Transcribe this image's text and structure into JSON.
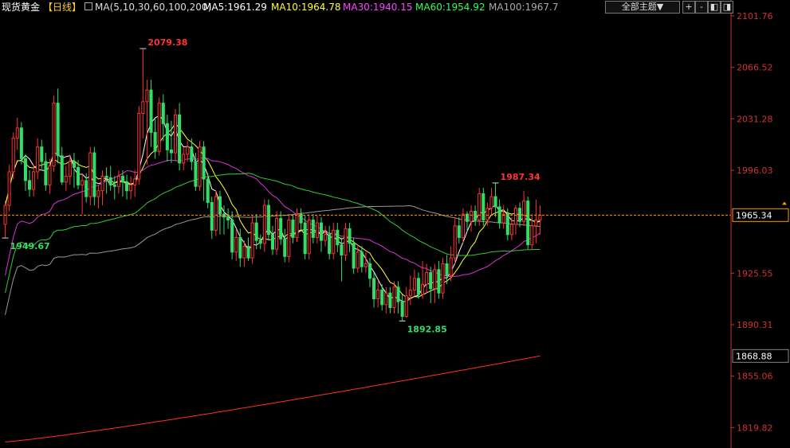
{
  "header": {
    "title": "现货黄金",
    "period": "【日线】",
    "ma_params": "MA(5,10,30,60,100,200)",
    "ma5": "MA5:1961.29",
    "ma10": "MA10:1964.78",
    "ma30": "MA30:1940.15",
    "ma60": "MA60:1954.92",
    "ma100": "MA100:1967.7",
    "theme_select": "全部主题▼",
    "tool_icons": [
      "zoom-in-icon",
      "zoom-out-icon",
      "left-icon",
      "right-icon"
    ],
    "tool_glyphs": [
      "+",
      "-",
      "◧",
      "◨"
    ]
  },
  "colors": {
    "up": "#ff3333",
    "down": "#33dd66",
    "ma5": "#ffffff",
    "ma10": "#ffff33",
    "ma30": "#dd33dd",
    "ma60": "#33cc33",
    "ma100": "#999999",
    "ma200": "#ff3322",
    "axis": "#cc3333",
    "current": "#ff9900"
  },
  "chart_data": {
    "type": "candlestick",
    "title": "现货黄金【日线】",
    "y_ticks": [
      2101.76,
      2066.52,
      2031.28,
      1996.03,
      1925.55,
      1890.31,
      1855.06,
      1819.82
    ],
    "y_tick_labels": [
      "2101.76",
      "2066.52",
      "2031.28",
      "1996.03",
      "1925.55",
      "1890.31",
      "1855.06",
      "1819.82"
    ],
    "ylim": [
      1800,
      2120
    ],
    "current_price": 1965.34,
    "current_price_label": "1965.34",
    "ma200_value": 1868.88,
    "ma200_label": "1868.88",
    "annotations": [
      {
        "label": "2079.38",
        "bar": 34,
        "value": 2079.38,
        "color": "#ff3333"
      },
      {
        "label": "1949.67",
        "bar": 0,
        "value": 1949.67,
        "color": "#33dd66"
      },
      {
        "label": "1987.34",
        "bar": 121,
        "value": 1987.34,
        "color": "#ff3333"
      },
      {
        "label": "1892.85",
        "bar": 98,
        "value": 1892.85,
        "color": "#33dd66"
      }
    ],
    "candles": [
      [
        1959,
        1972,
        1950,
        1975
      ],
      [
        1972,
        1995,
        1968,
        2000
      ],
      [
        1995,
        2018,
        1990,
        2022
      ],
      [
        2018,
        2025,
        2010,
        2032
      ],
      [
        2025,
        2004,
        2000,
        2029
      ],
      [
        2004,
        1989,
        1982,
        2007
      ],
      [
        1989,
        1983,
        1978,
        1996
      ],
      [
        1983,
        1995,
        1978,
        2000
      ],
      [
        1995,
        2012,
        1990,
        2018
      ],
      [
        2012,
        2002,
        1997,
        2017
      ],
      [
        2002,
        1986,
        1982,
        2008
      ],
      [
        1986,
        1999,
        1980,
        2004
      ],
      [
        1999,
        2042,
        1995,
        2047
      ],
      [
        2042,
        2006,
        2001,
        2052
      ],
      [
        2006,
        1988,
        1986,
        2012
      ],
      [
        1988,
        1992,
        1982,
        1999
      ],
      [
        1992,
        2002,
        1986,
        2007
      ],
      [
        2002,
        1998,
        1984,
        2008
      ],
      [
        1998,
        1986,
        1983,
        2003
      ],
      [
        1986,
        1989,
        1966,
        1994
      ],
      [
        1989,
        1978,
        1974,
        1994
      ],
      [
        1978,
        2008,
        1972,
        2012
      ],
      [
        2008,
        1978,
        1972,
        2012
      ],
      [
        1978,
        1982,
        1970,
        1986
      ],
      [
        1982,
        1992,
        1972,
        1996
      ],
      [
        1992,
        1991,
        1980,
        1998
      ],
      [
        1991,
        1986,
        1982,
        1999
      ],
      [
        1986,
        1985,
        1976,
        1992
      ],
      [
        1985,
        1992,
        1980,
        1996
      ],
      [
        1992,
        1988,
        1978,
        1996
      ],
      [
        1988,
        1982,
        1976,
        1993
      ],
      [
        1982,
        1986,
        1976,
        1992
      ],
      [
        1986,
        1990,
        1978,
        1996
      ],
      [
        1990,
        2035,
        1986,
        2040
      ],
      [
        2035,
        2043,
        2018,
        2079.38
      ],
      [
        2043,
        2051,
        2000,
        2058
      ],
      [
        2051,
        2022,
        2012,
        2058
      ],
      [
        2022,
        2009,
        2004,
        2032
      ],
      [
        2009,
        2042,
        2006,
        2046
      ],
      [
        2042,
        2028,
        2016,
        2048
      ],
      [
        2028,
        2010,
        2002,
        2034
      ],
      [
        2010,
        2008,
        2001,
        2030
      ],
      [
        2008,
        2034,
        2002,
        2038
      ],
      [
        2034,
        2001,
        1996,
        2042
      ],
      [
        2001,
        2007,
        1996,
        2012
      ],
      [
        2007,
        2012,
        2002,
        2016
      ],
      [
        2012,
        2002,
        1996,
        2018
      ],
      [
        2002,
        1985,
        1982,
        2008
      ],
      [
        1985,
        2012,
        1982,
        2016
      ],
      [
        2012,
        1990,
        1975,
        2016
      ],
      [
        1990,
        1974,
        1970,
        1994
      ],
      [
        1974,
        1955,
        1949,
        1978
      ],
      [
        1955,
        1978,
        1951,
        1982
      ],
      [
        1978,
        1966,
        1952,
        1982
      ],
      [
        1966,
        1964,
        1952,
        1972
      ],
      [
        1964,
        1962,
        1956,
        1970
      ],
      [
        1962,
        1940,
        1935,
        1968
      ],
      [
        1940,
        1950,
        1934,
        1956
      ],
      [
        1950,
        1936,
        1930,
        1956
      ],
      [
        1936,
        1944,
        1930,
        1948
      ],
      [
        1944,
        1936,
        1934,
        1950
      ],
      [
        1936,
        1960,
        1932,
        1965
      ],
      [
        1960,
        1948,
        1942,
        1966
      ],
      [
        1948,
        1946,
        1942,
        1952
      ],
      [
        1946,
        1972,
        1940,
        1976
      ],
      [
        1972,
        1952,
        1948,
        1976
      ],
      [
        1952,
        1942,
        1938,
        1958
      ],
      [
        1942,
        1963,
        1938,
        1968
      ],
      [
        1963,
        1949,
        1945,
        1968
      ],
      [
        1949,
        1937,
        1933,
        1956
      ],
      [
        1937,
        1962,
        1933,
        1966
      ],
      [
        1962,
        1950,
        1946,
        1966
      ],
      [
        1950,
        1966,
        1947,
        1970
      ],
      [
        1966,
        1960,
        1954,
        1970
      ],
      [
        1960,
        1939,
        1935,
        1965
      ],
      [
        1939,
        1962,
        1935,
        1966
      ],
      [
        1962,
        1950,
        1946,
        1966
      ],
      [
        1950,
        1960,
        1946,
        1965
      ],
      [
        1960,
        1948,
        1940,
        1964
      ],
      [
        1948,
        1952,
        1944,
        1958
      ],
      [
        1952,
        1939,
        1935,
        1958
      ],
      [
        1939,
        1955,
        1935,
        1960
      ],
      [
        1955,
        1945,
        1940,
        1960
      ],
      [
        1945,
        1938,
        1920,
        1950
      ],
      [
        1938,
        1956,
        1934,
        1960
      ],
      [
        1956,
        1946,
        1940,
        1960
      ],
      [
        1946,
        1929,
        1925,
        1950
      ],
      [
        1929,
        1940,
        1926,
        1944
      ],
      [
        1940,
        1930,
        1926,
        1944
      ],
      [
        1930,
        1932,
        1926,
        1940
      ],
      [
        1932,
        1922,
        1916,
        1936
      ],
      [
        1922,
        1908,
        1902,
        1926
      ],
      [
        1908,
        1914,
        1902,
        1920
      ],
      [
        1914,
        1904,
        1900,
        1918
      ],
      [
        1904,
        1912,
        1898,
        1916
      ],
      [
        1912,
        1902,
        1898,
        1916
      ],
      [
        1902,
        1916,
        1898,
        1920
      ],
      [
        1916,
        1906,
        1898,
        1920
      ],
      [
        1906,
        1896,
        1892.85,
        1911
      ],
      [
        1896,
        1910,
        1895,
        1916
      ],
      [
        1910,
        1914,
        1904,
        1924
      ],
      [
        1914,
        1922,
        1910,
        1928
      ],
      [
        1922,
        1911,
        1908,
        1926
      ],
      [
        1911,
        1918,
        1908,
        1934
      ],
      [
        1918,
        1926,
        1912,
        1932
      ],
      [
        1926,
        1915,
        1905,
        1930
      ],
      [
        1915,
        1928,
        1905,
        1932
      ],
      [
        1928,
        1912,
        1908,
        1934
      ],
      [
        1912,
        1932,
        1908,
        1936
      ],
      [
        1932,
        1924,
        1918,
        1938
      ],
      [
        1924,
        1936,
        1920,
        1944
      ],
      [
        1936,
        1958,
        1932,
        1964
      ],
      [
        1958,
        1950,
        1946,
        1964
      ],
      [
        1950,
        1966,
        1946,
        1970
      ],
      [
        1966,
        1961,
        1954,
        1968
      ],
      [
        1961,
        1968,
        1954,
        1972
      ],
      [
        1968,
        1962,
        1958,
        1972
      ],
      [
        1962,
        1980,
        1958,
        1984
      ],
      [
        1980,
        1962,
        1958,
        1984
      ],
      [
        1962,
        1970,
        1958,
        1974
      ],
      [
        1970,
        1978,
        1966,
        1984
      ],
      [
        1978,
        1971,
        1964,
        1987.34
      ],
      [
        1971,
        1960,
        1956,
        1976
      ],
      [
        1960,
        1966,
        1956,
        1972
      ],
      [
        1966,
        1952,
        1948,
        1970
      ],
      [
        1952,
        1959,
        1948,
        1964
      ],
      [
        1959,
        1970,
        1952,
        1972
      ],
      [
        1970,
        1961,
        1957,
        1974
      ],
      [
        1961,
        1975,
        1958,
        1982
      ],
      [
        1975,
        1945,
        1942,
        1978
      ],
      [
        1945,
        1958,
        1942,
        1966
      ],
      [
        1958,
        1962,
        1946,
        1976
      ],
      [
        1962,
        1965.34,
        1952,
        1972
      ]
    ]
  }
}
